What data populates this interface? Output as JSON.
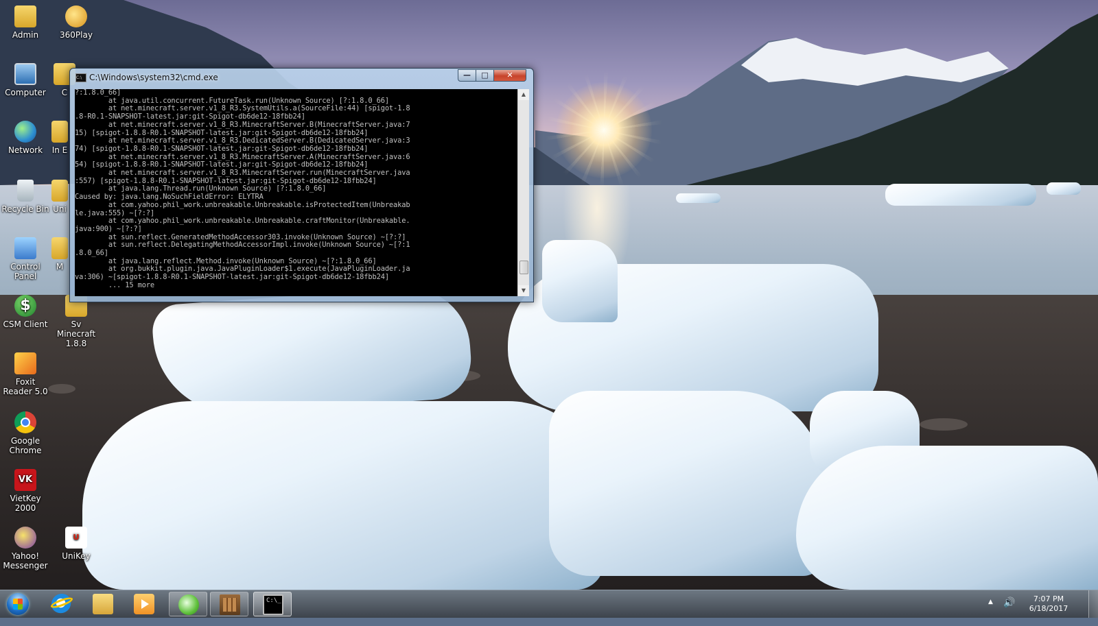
{
  "desktop_icons": [
    {
      "id": "admin",
      "label": "Admin",
      "icon": "user-folder-icon"
    },
    {
      "id": "360play",
      "label": "360Play",
      "icon": "360play-icon"
    },
    {
      "id": "computer",
      "label": "Computer",
      "icon": "computer-icon"
    },
    {
      "id": "c-partial",
      "label": "C",
      "icon": "folder-icon"
    },
    {
      "id": "network",
      "label": "Network",
      "icon": "network-icon"
    },
    {
      "id": "in-partial",
      "label": "In E",
      "icon": "folder-icon"
    },
    {
      "id": "recycle",
      "label": "Recycle Bin",
      "icon": "recycle-bin-icon"
    },
    {
      "id": "uni-partial",
      "label": "Uni",
      "icon": "folder-icon"
    },
    {
      "id": "controlpanel",
      "label": "Control Panel",
      "icon": "control-panel-icon"
    },
    {
      "id": "m-partial",
      "label": "M",
      "icon": "folder-icon"
    },
    {
      "id": "csm",
      "label": "CSM Client",
      "icon": "dollar-icon"
    },
    {
      "id": "svminecraft",
      "label": "Sv Minecraft 1.8.8",
      "icon": "folder-icon"
    },
    {
      "id": "foxit",
      "label": "Foxit Reader 5.0",
      "icon": "foxit-reader-icon"
    },
    {
      "id": "chrome",
      "label": "Google Chrome",
      "icon": "chrome-icon"
    },
    {
      "id": "vietkey",
      "label": "VietKey 2000",
      "icon": "vietkey-icon"
    },
    {
      "id": "yahoo",
      "label": "Yahoo! Messenger",
      "icon": "yahoo-messenger-icon"
    },
    {
      "id": "unikey",
      "label": "UniKey",
      "icon": "unikey-icon"
    }
  ],
  "cmd_window": {
    "title": "C:\\Windows\\system32\\cmd.exe",
    "buttons": {
      "minimize": "—",
      "maximize": "□",
      "close": "✕"
    },
    "lines": [
      "?:1.8.0_66]",
      "        at java.util.concurrent.FutureTask.run(Unknown Source) [?:1.8.0_66]",
      "        at net.minecraft.server.v1_8_R3.SystemUtils.a(SourceFile:44) [spigot-1.8",
      ".8-R0.1-SNAPSHOT-latest.jar:git-Spigot-db6de12-18fbb24]",
      "        at net.minecraft.server.v1_8_R3.MinecraftServer.B(MinecraftServer.java:7",
      "15) [spigot-1.8.8-R0.1-SNAPSHOT-latest.jar:git-Spigot-db6de12-18fbb24]",
      "        at net.minecraft.server.v1_8_R3.DedicatedServer.B(DedicatedServer.java:3",
      "74) [spigot-1.8.8-R0.1-SNAPSHOT-latest.jar:git-Spigot-db6de12-18fbb24]",
      "        at net.minecraft.server.v1_8_R3.MinecraftServer.A(MinecraftServer.java:6",
      "54) [spigot-1.8.8-R0.1-SNAPSHOT-latest.jar:git-Spigot-db6de12-18fbb24]",
      "        at net.minecraft.server.v1_8_R3.MinecraftServer.run(MinecraftServer.java",
      ":557) [spigot-1.8.8-R0.1-SNAPSHOT-latest.jar:git-Spigot-db6de12-18fbb24]",
      "        at java.lang.Thread.run(Unknown Source) [?:1.8.0_66]",
      "Caused by: java.lang.NoSuchFieldError: ELYTRA",
      "        at com.yahoo.phil_work.unbreakable.Unbreakable.isProtectedItem(Unbreakab",
      "le.java:555) ~[?:?]",
      "        at com.yahoo.phil_work.unbreakable.Unbreakable.craftMonitor(Unbreakable.",
      "java:900) ~[?:?]",
      "        at sun.reflect.GeneratedMethodAccessor303.invoke(Unknown Source) ~[?:?]",
      "        at sun.reflect.DelegatingMethodAccessorImpl.invoke(Unknown Source) ~[?:1",
      ".8.0_66]",
      "        at java.lang.reflect.Method.invoke(Unknown Source) ~[?:1.8.0_66]",
      "        at org.bukkit.plugin.java.JavaPluginLoader$1.execute(JavaPluginLoader.ja",
      "va:306) ~[spigot-1.8.8-R0.1-SNAPSHOT-latest.jar:git-Spigot-db6de12-18fbb24]",
      "        ... 15 more"
    ]
  },
  "taskbar": {
    "start_icon": "windows-start-orb-icon",
    "items": [
      {
        "id": "ie",
        "icon": "internet-explorer-icon",
        "state": "pinned"
      },
      {
        "id": "explorer",
        "icon": "windows-explorer-icon",
        "state": "pinned"
      },
      {
        "id": "media",
        "icon": "media-player-icon",
        "state": "pinned"
      },
      {
        "id": "360",
        "icon": "360-browser-icon",
        "state": "open"
      },
      {
        "id": "minecraft",
        "icon": "minecraft-icon",
        "state": "open"
      },
      {
        "id": "cmd",
        "icon": "command-prompt-icon",
        "state": "active",
        "glyph": "C:\\_"
      }
    ],
    "tray": {
      "show_hidden": "▲",
      "volume": "🔊"
    },
    "clock": {
      "time": "7:07 PM",
      "date": "6/18/2017"
    }
  }
}
